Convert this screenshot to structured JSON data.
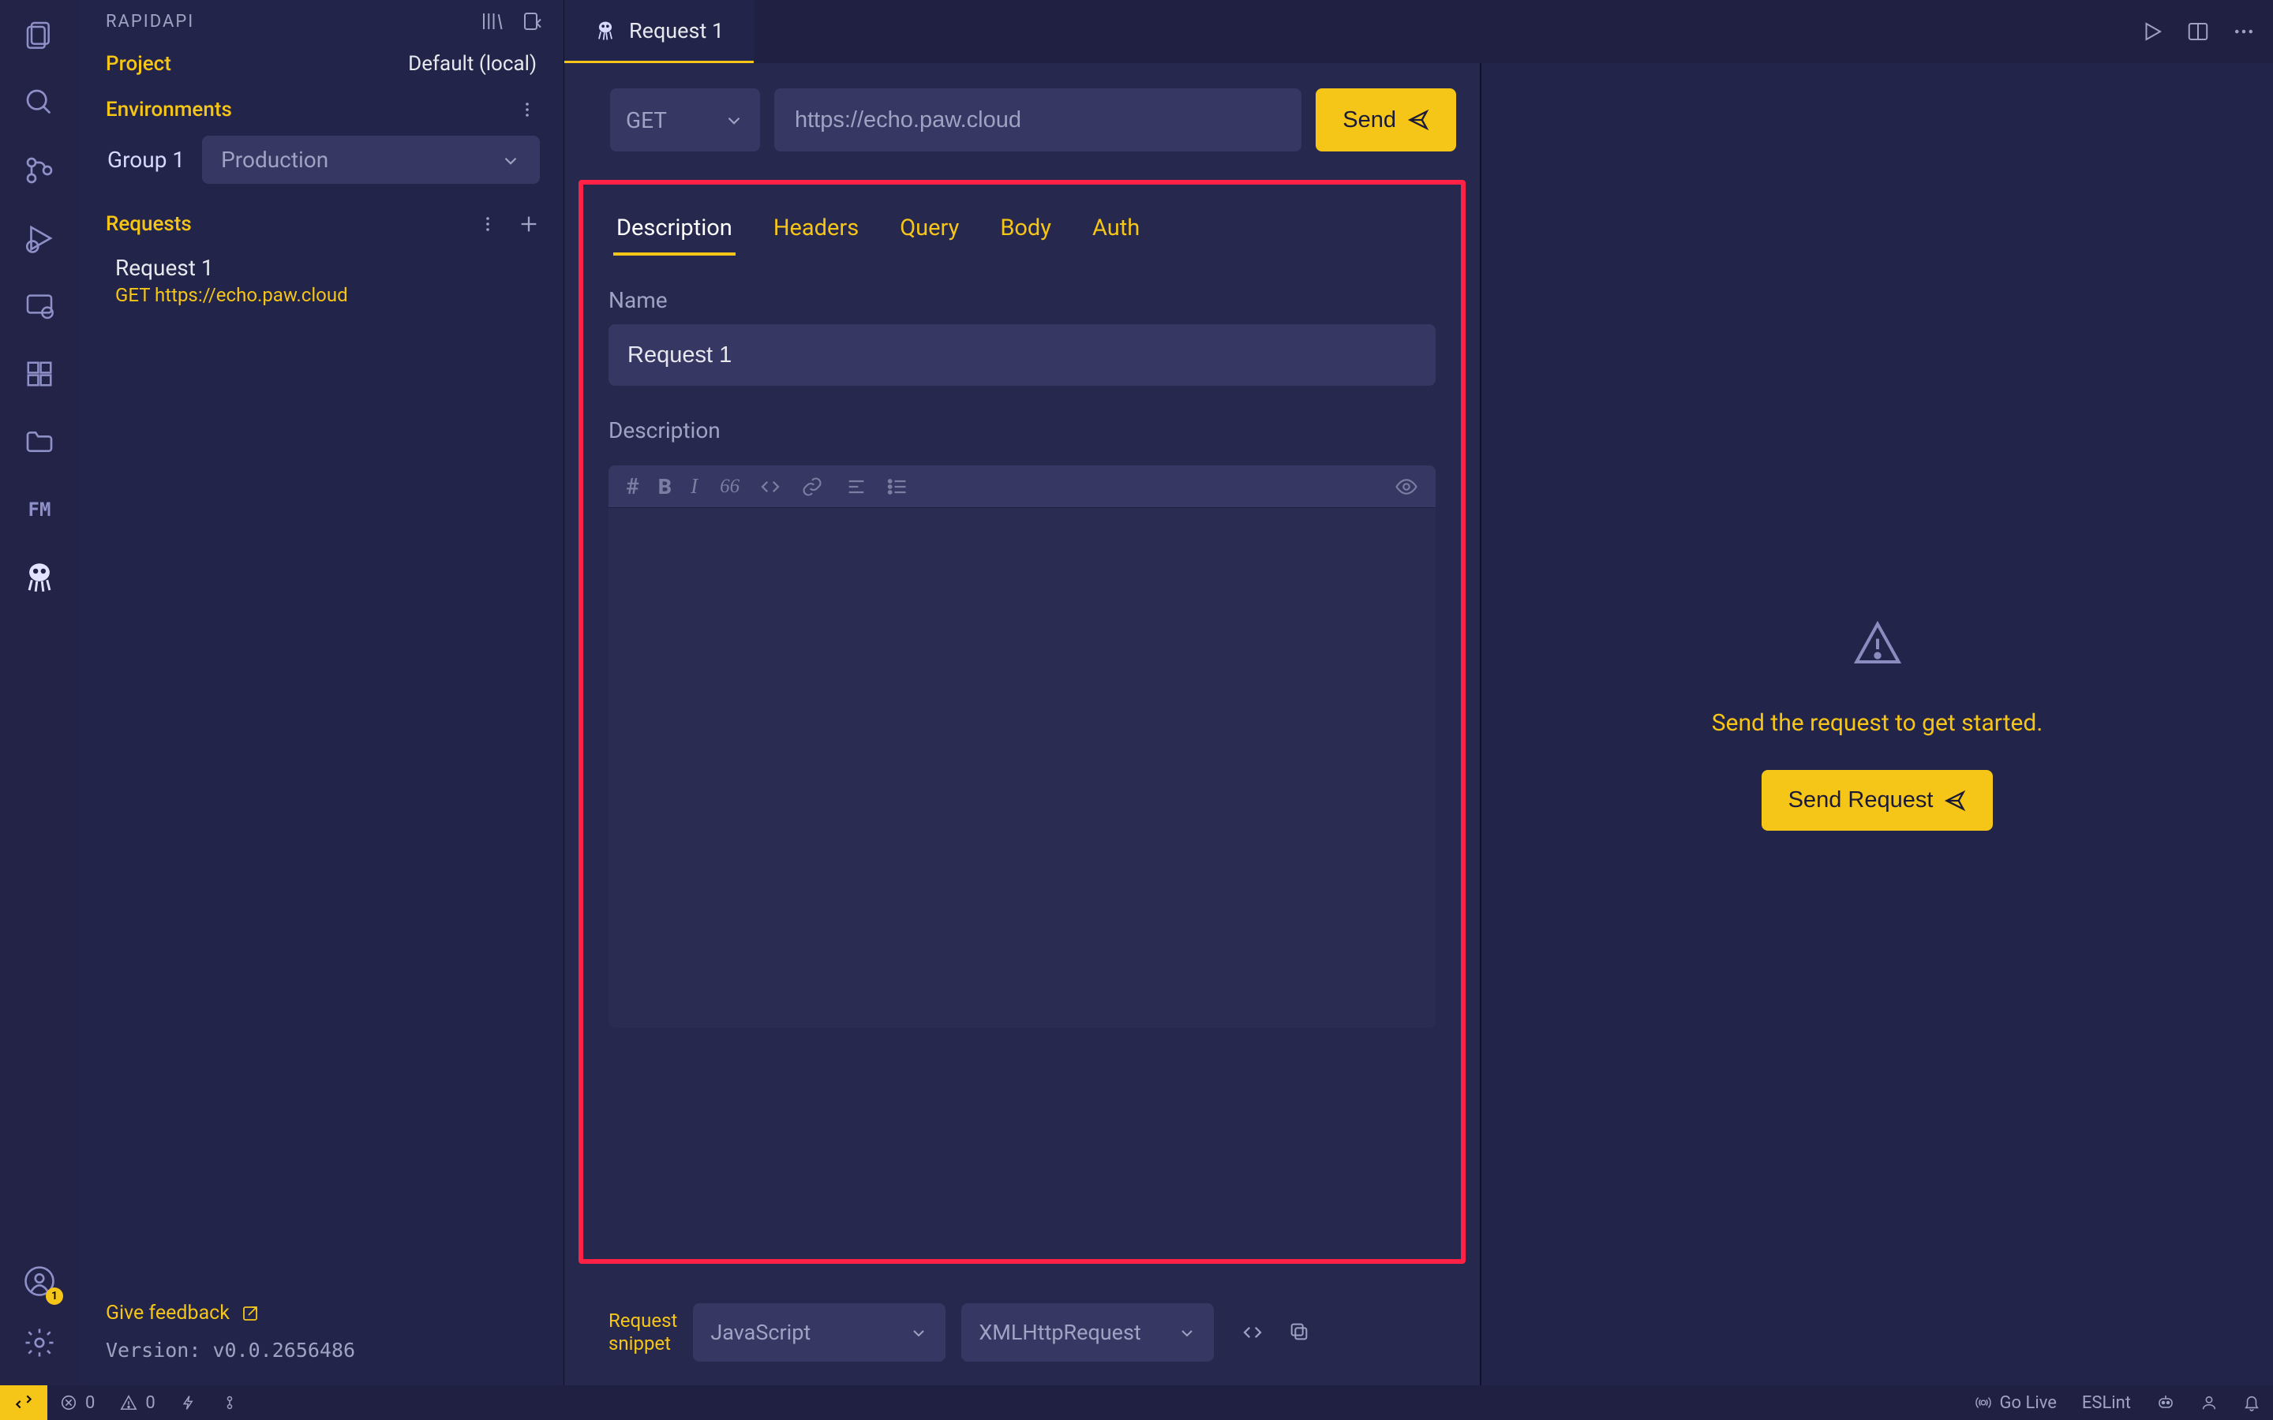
{
  "activity": {
    "accountBadge": "1"
  },
  "sidebar": {
    "title": "RAPIDAPI",
    "projectLabel": "Project",
    "projectValue": "Default (local)",
    "envLabel": "Environments",
    "groupLabel": "Group 1",
    "envValue": "Production",
    "requestsLabel": "Requests",
    "requests": [
      {
        "title": "Request 1",
        "subtitle": "GET https://echo.paw.cloud"
      }
    ],
    "feedback": "Give feedback",
    "version": "Version: v0.0.2656486"
  },
  "tabs": {
    "activeTitle": "Request 1"
  },
  "request": {
    "method": "GET",
    "url": "https://echo.paw.cloud",
    "sendLabel": "Send",
    "innerTabs": [
      "Description",
      "Headers",
      "Query",
      "Body",
      "Auth"
    ],
    "nameLabel": "Name",
    "nameValue": "Request 1",
    "descLabel": "Description"
  },
  "snippet": {
    "label1": "Request",
    "label2": "snippet",
    "language": "JavaScript",
    "library": "XMLHttpRequest"
  },
  "response": {
    "message": "Send the request to get started.",
    "button": "Send Request"
  },
  "status": {
    "errors": "0",
    "warnings": "0",
    "goLive": "Go Live",
    "eslint": "ESLint"
  }
}
